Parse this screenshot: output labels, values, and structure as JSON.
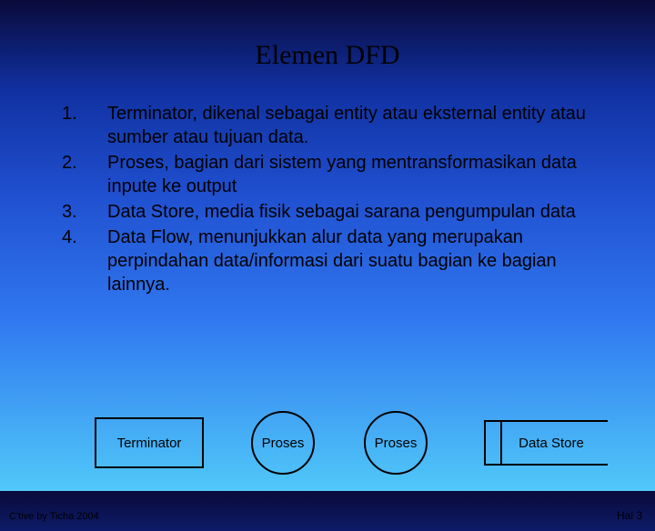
{
  "title": "Elemen DFD",
  "items": [
    {
      "num": "1.",
      "text": "Terminator, dikenal sebagai entity atau eksternal entity atau sumber atau tujuan data."
    },
    {
      "num": "2.",
      "text": "Proses, bagian dari sistem yang mentransformasikan data inpute ke output"
    },
    {
      "num": "3.",
      "text": "Data Store, media fisik sebagai sarana pengumpulan data"
    },
    {
      "num": "4.",
      "text": "Data Flow, menunjukkan alur data yang merupakan perpindahan data/informasi dari suatu bagian ke bagian lainnya."
    }
  ],
  "shapes": {
    "terminator": "Terminator",
    "proses1": "Proses",
    "proses2": "Proses",
    "datastore": "Data Store"
  },
  "footer": {
    "left": "C'tive by Ticha 2004",
    "right": "Hal 3"
  }
}
